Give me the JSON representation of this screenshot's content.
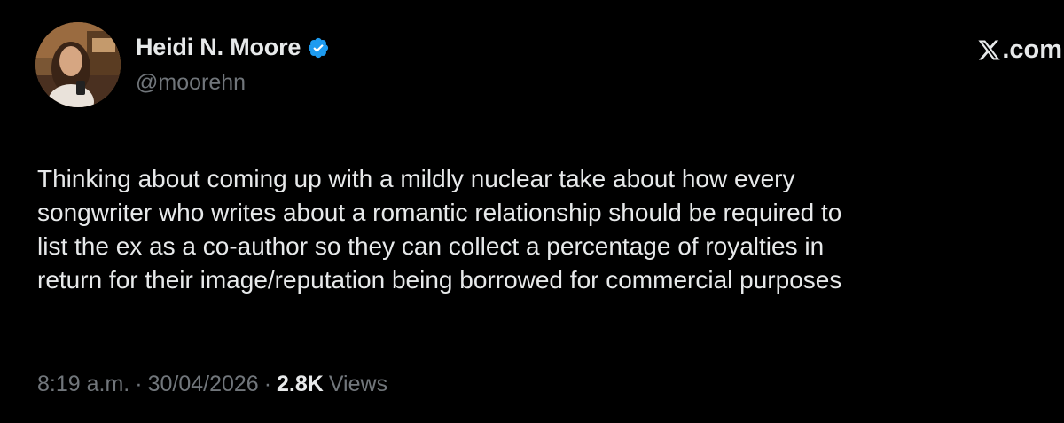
{
  "author": {
    "display_name": "Heidi N. Moore",
    "handle": "@moorehn",
    "verified": true,
    "avatar_icon": "profile-photo"
  },
  "brand": {
    "label": ".com",
    "icon": "x-logo-icon"
  },
  "tweet": {
    "lines": [
      "Thinking about coming up with a mildly nuclear take about how every",
      "songwriter who writes about a romantic relationship should be required to",
      "list the ex as a co-author so they can collect a percentage of royalties in",
      "return for their image/reputation being borrowed for commercial purposes"
    ]
  },
  "meta": {
    "time": "8:19 a.m.",
    "separator": "·",
    "date": "30/04/2026",
    "view_count": "2.8K",
    "views_label": "Views"
  },
  "colors": {
    "background": "#000000",
    "primary_text": "#e7e9ea",
    "secondary_text": "#71767b",
    "verified_blue": "#1d9bf0"
  }
}
